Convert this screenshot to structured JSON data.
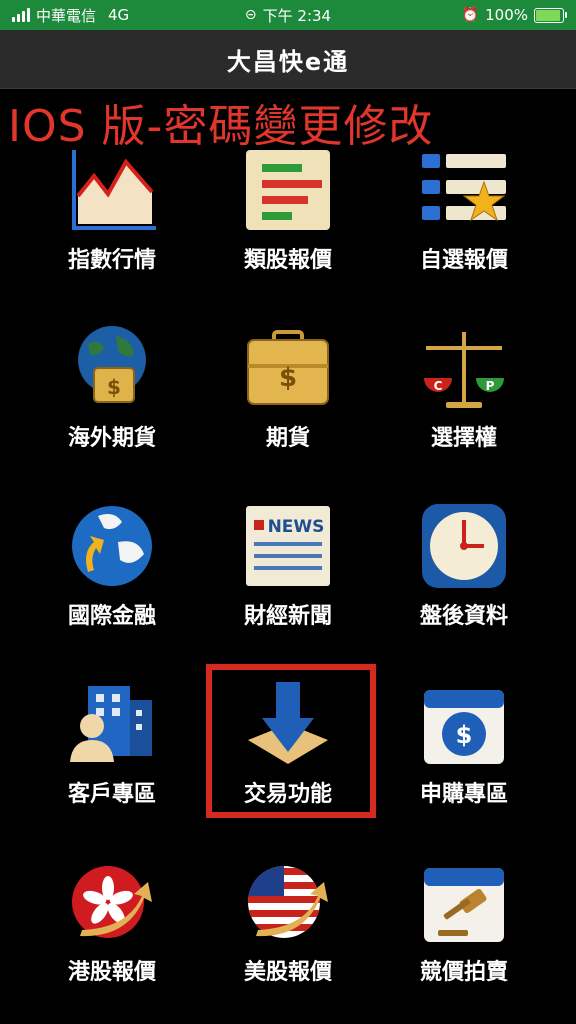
{
  "status_bar": {
    "carrier": "中華電信",
    "network": "4G",
    "time": "下午 2:34",
    "battery_percent": "100%"
  },
  "nav": {
    "title": "大昌快e通"
  },
  "overlay_title": "IOS 版-密碼變更修改",
  "menu": [
    {
      "label": "指數行情",
      "icon": "line-chart-icon"
    },
    {
      "label": "類股報價",
      "icon": "bar-report-icon"
    },
    {
      "label": "自選報價",
      "icon": "star-list-icon"
    },
    {
      "label": "海外期貨",
      "icon": "globe-briefcase-icon"
    },
    {
      "label": "期貨",
      "icon": "briefcase-dollar-icon"
    },
    {
      "label": "選擇權",
      "icon": "scale-icon"
    },
    {
      "label": "國際金融",
      "icon": "globe-arrow-icon"
    },
    {
      "label": "財經新聞",
      "icon": "news-icon"
    },
    {
      "label": "盤後資料",
      "icon": "clock-icon"
    },
    {
      "label": "客戶專區",
      "icon": "customer-building-icon"
    },
    {
      "label": "交易功能",
      "icon": "download-arrow-icon"
    },
    {
      "label": "申購專區",
      "icon": "calendar-dollar-icon"
    },
    {
      "label": "港股報價",
      "icon": "hk-flag-icon"
    },
    {
      "label": "美股報價",
      "icon": "us-flag-icon"
    },
    {
      "label": "競價拍賣",
      "icon": "calendar-gavel-icon"
    }
  ],
  "colors": {
    "status_bar": "#1c8a3a",
    "nav_bar": "#2b2b2b",
    "overlay": "#e0362c",
    "highlight": "#d62a1e"
  }
}
